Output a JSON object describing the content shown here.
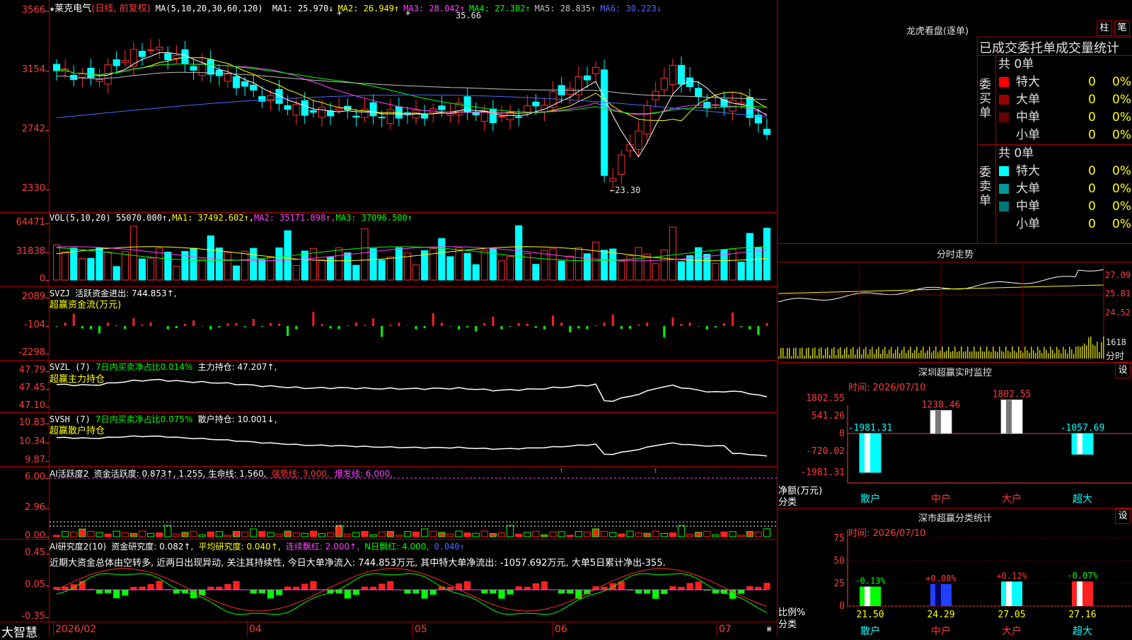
{
  "stock": {
    "star": "★",
    "name": "莱克电气",
    "mode": "(日线, 前复权)"
  },
  "main_header": {
    "ma_label": "MA(5,10,20,30,60,120)",
    "items": [
      {
        "name": "MA1:",
        "value": "25.970",
        "arrow": "↓",
        "color": "#ffffff"
      },
      {
        "name": "MA2:",
        "value": "26.949",
        "arrow": "↑",
        "color": "#ffff00"
      },
      {
        "name": "MA3:",
        "value": "28.042",
        "arrow": "↑",
        "color": "#ff44ff"
      },
      {
        "name": "MA4:",
        "value": "27.302",
        "arrow": "↑",
        "color": "#00ff00"
      },
      {
        "name": "MA5:",
        "value": "28.835",
        "arrow": "↑",
        "color": "#c0c0c0"
      },
      {
        "name": "MA6:",
        "value": "30.223",
        "arrow": "↓",
        "color": "#4b6bff"
      }
    ]
  },
  "main_axis": [
    "3566",
    "3154",
    "2742",
    "2330"
  ],
  "price_marks": {
    "high": "35.66",
    "low": "←23.30"
  },
  "vol_header": {
    "label": "VOL(5,10,20)",
    "value": "55070.000↑,",
    "ma1": "MA1: 37492.602↑,",
    "ma2": "MA2: 35171.898↑,",
    "ma3": "MA3: 37096.500↑"
  },
  "vol_axis": [
    "64471",
    "31838",
    "0"
  ],
  "svzj": {
    "label": "SVZJ",
    "text": "活跃资金进出: 744.853↑,",
    "sub": "超赢资金流(万元)",
    "axis": [
      "2089",
      "-104",
      "-2298"
    ]
  },
  "svzl": {
    "label": "SVZL (7)",
    "green": "7日内买卖净占比0.014%",
    "white": "主力持仓: 47.207↑,",
    "sub": "超赢主力持仓",
    "axis": [
      "47.79",
      "47.45",
      "47.10"
    ]
  },
  "svsh": {
    "label": "SVSH (7)",
    "green": "7日内买卖净占比0.075%",
    "white": "散户持仓: 10.001↓,",
    "sub": "超赢散户持仓",
    "axis": [
      "10.83",
      "10.34",
      "9.87"
    ]
  },
  "ai_active": {
    "label": "AI活跃度2",
    "white": "资金活跃度: 0.873↑, 1.255, 生命线: 1.560,",
    "red": "强势线: 3.000,",
    "mag": "爆发线: 6.000,",
    "axis": [
      "6.00",
      "2.96",
      "0.00"
    ]
  },
  "ai_research": {
    "label": "AI研究度2(10)",
    "white": "资金研究度: 0.082↑,",
    "yellow": "平均研究度: 0.040↑,",
    "mag": "连续飘红: 2.000↑,",
    "green": "N日飘红: 4.000,",
    "blue": "0.040↑",
    "comment": "近期大资金总体由空转多, 近两日出现异动, 关注其持续性, 今日大单净流入: 744.853万元, 其中特大单净流出: -1057.692万元, 大单5日累计净出-355.",
    "axis": [
      "0.45",
      "0.05",
      "-0.35"
    ]
  },
  "date_axis": [
    "2026/02",
    "04",
    "05",
    "06",
    "07"
  ],
  "brand": "大智慧",
  "lhb": {
    "title": "龙虎看盘(逐单)",
    "btn1": "柱",
    "btn2": "笔",
    "subtitle": "已成交委托单成交量统计",
    "buy": {
      "side": "委买单",
      "total": "共 0单",
      "rows": [
        {
          "label": "特大",
          "v": "0",
          "p": "0%",
          "color": "#ff0000"
        },
        {
          "label": "大单",
          "v": "0",
          "p": "0%",
          "color": "#990000"
        },
        {
          "label": "中单",
          "v": "0",
          "p": "0%",
          "color": "#660000"
        },
        {
          "label": "小单",
          "v": "0",
          "p": "0%",
          "color": ""
        }
      ]
    },
    "sell": {
      "side": "委卖单",
      "total": "共 0单",
      "rows": [
        {
          "label": "特大",
          "v": "0",
          "p": "0%",
          "color": "#00ffff"
        },
        {
          "label": "大单",
          "v": "0",
          "p": "0%",
          "color": "#009999"
        },
        {
          "label": "中单",
          "v": "0",
          "p": "0%",
          "color": "#007777"
        },
        {
          "label": "小单",
          "v": "0",
          "p": "0%",
          "color": ""
        }
      ]
    }
  },
  "intraday": {
    "title": "分时走势",
    "axis": [
      "27.09",
      "25.81",
      "24.52"
    ],
    "vol_top": "1618",
    "vol_label": "分时"
  },
  "sz_monitor": {
    "title": "深圳超赢实时监控",
    "btn": "设",
    "date_label": "时间: 2026/07/10",
    "axis": [
      "1802.55",
      "541.26",
      "0",
      "-720.02",
      "-1981.31"
    ],
    "y_unit": "净额(万元)",
    "x_unit": "分类",
    "categories": [
      "散户",
      "中户",
      "大户",
      "超大"
    ],
    "values": [
      -1981.31,
      1238.46,
      1802.55,
      -1057.69
    ],
    "value_labels": [
      "-1981.31",
      "1238.46",
      "1802.55",
      "-1057.69"
    ]
  },
  "sz_class": {
    "title": "深市超赢分类统计",
    "btn": "设",
    "date_label": "时间: 2026/07/10",
    "axis": [
      "75",
      "50",
      "25",
      "0"
    ],
    "y_unit": "比例%",
    "x_unit": "分类",
    "categories": [
      "散户",
      "中户",
      "大户",
      "超大"
    ],
    "values": [
      21.5,
      24.29,
      27.05,
      27.16
    ],
    "value_labels": [
      "21.50",
      "24.29",
      "27.05",
      "27.16"
    ],
    "changes": [
      "-0.13%",
      "+0.08%",
      "+0.12%",
      "-0.07%"
    ],
    "colors": [
      "#00ff00",
      "#2040ff",
      "#00ffff",
      "#ff2020"
    ]
  }
}
